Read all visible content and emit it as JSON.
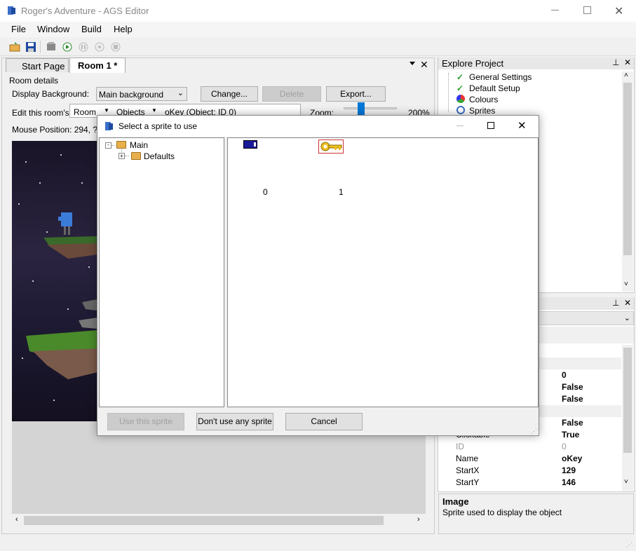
{
  "window": {
    "title": "Roger's Adventure - AGS Editor"
  },
  "menu": [
    "File",
    "Window",
    "Build",
    "Help"
  ],
  "toolbar": {
    "icons": [
      "open-folder-icon",
      "save-icon",
      "build-icon",
      "run-icon",
      "pause-icon",
      "step-icon",
      "stop-icon"
    ]
  },
  "tabs": {
    "start_page": "Start Page",
    "room": "Room 1 *"
  },
  "room": {
    "details_label": "Room details",
    "display_bg_label": "Display Background:",
    "display_bg_value": "Main background",
    "change_btn": "Change...",
    "delete_btn": "Delete",
    "export_btn": "Export...",
    "edit_label": "Edit this room's:",
    "edit_mode": "Room",
    "edit_layer": "Objects",
    "edit_object": "oKey (Object; ID 0)",
    "zoom_label": "Zoom:",
    "zoom_value": "200%",
    "mouse_position": "Mouse Position: 294, ?"
  },
  "explore": {
    "title": "Explore Project",
    "items": [
      "General Settings",
      "Default Setup",
      "Colours",
      "Sprites"
    ]
  },
  "properties": {
    "rows": [
      {
        "key": "",
        "value": "0"
      },
      {
        "key": "",
        "value": "False"
      },
      {
        "key": "",
        "value": "False"
      },
      {
        "key": "",
        "value": "False"
      },
      {
        "key": "Clickable",
        "value": "True"
      },
      {
        "key": "ID",
        "value": "0"
      },
      {
        "key": "Name",
        "value": "oKey"
      },
      {
        "key": "StartX",
        "value": "129"
      },
      {
        "key": "StartY",
        "value": "146"
      }
    ],
    "desc_title": "Image",
    "desc_text": "Sprite used to display the object"
  },
  "dialog": {
    "title": "Select a sprite to use",
    "tree_root": "Main",
    "tree_child": "Defaults",
    "sprites": [
      {
        "label": "0"
      },
      {
        "label": "1"
      }
    ],
    "use_btn": "Use this sprite",
    "none_btn": "Don't use any sprite",
    "cancel_btn": "Cancel"
  },
  "colors": {
    "accent": "#0078d7",
    "selection": "#cc3333"
  }
}
